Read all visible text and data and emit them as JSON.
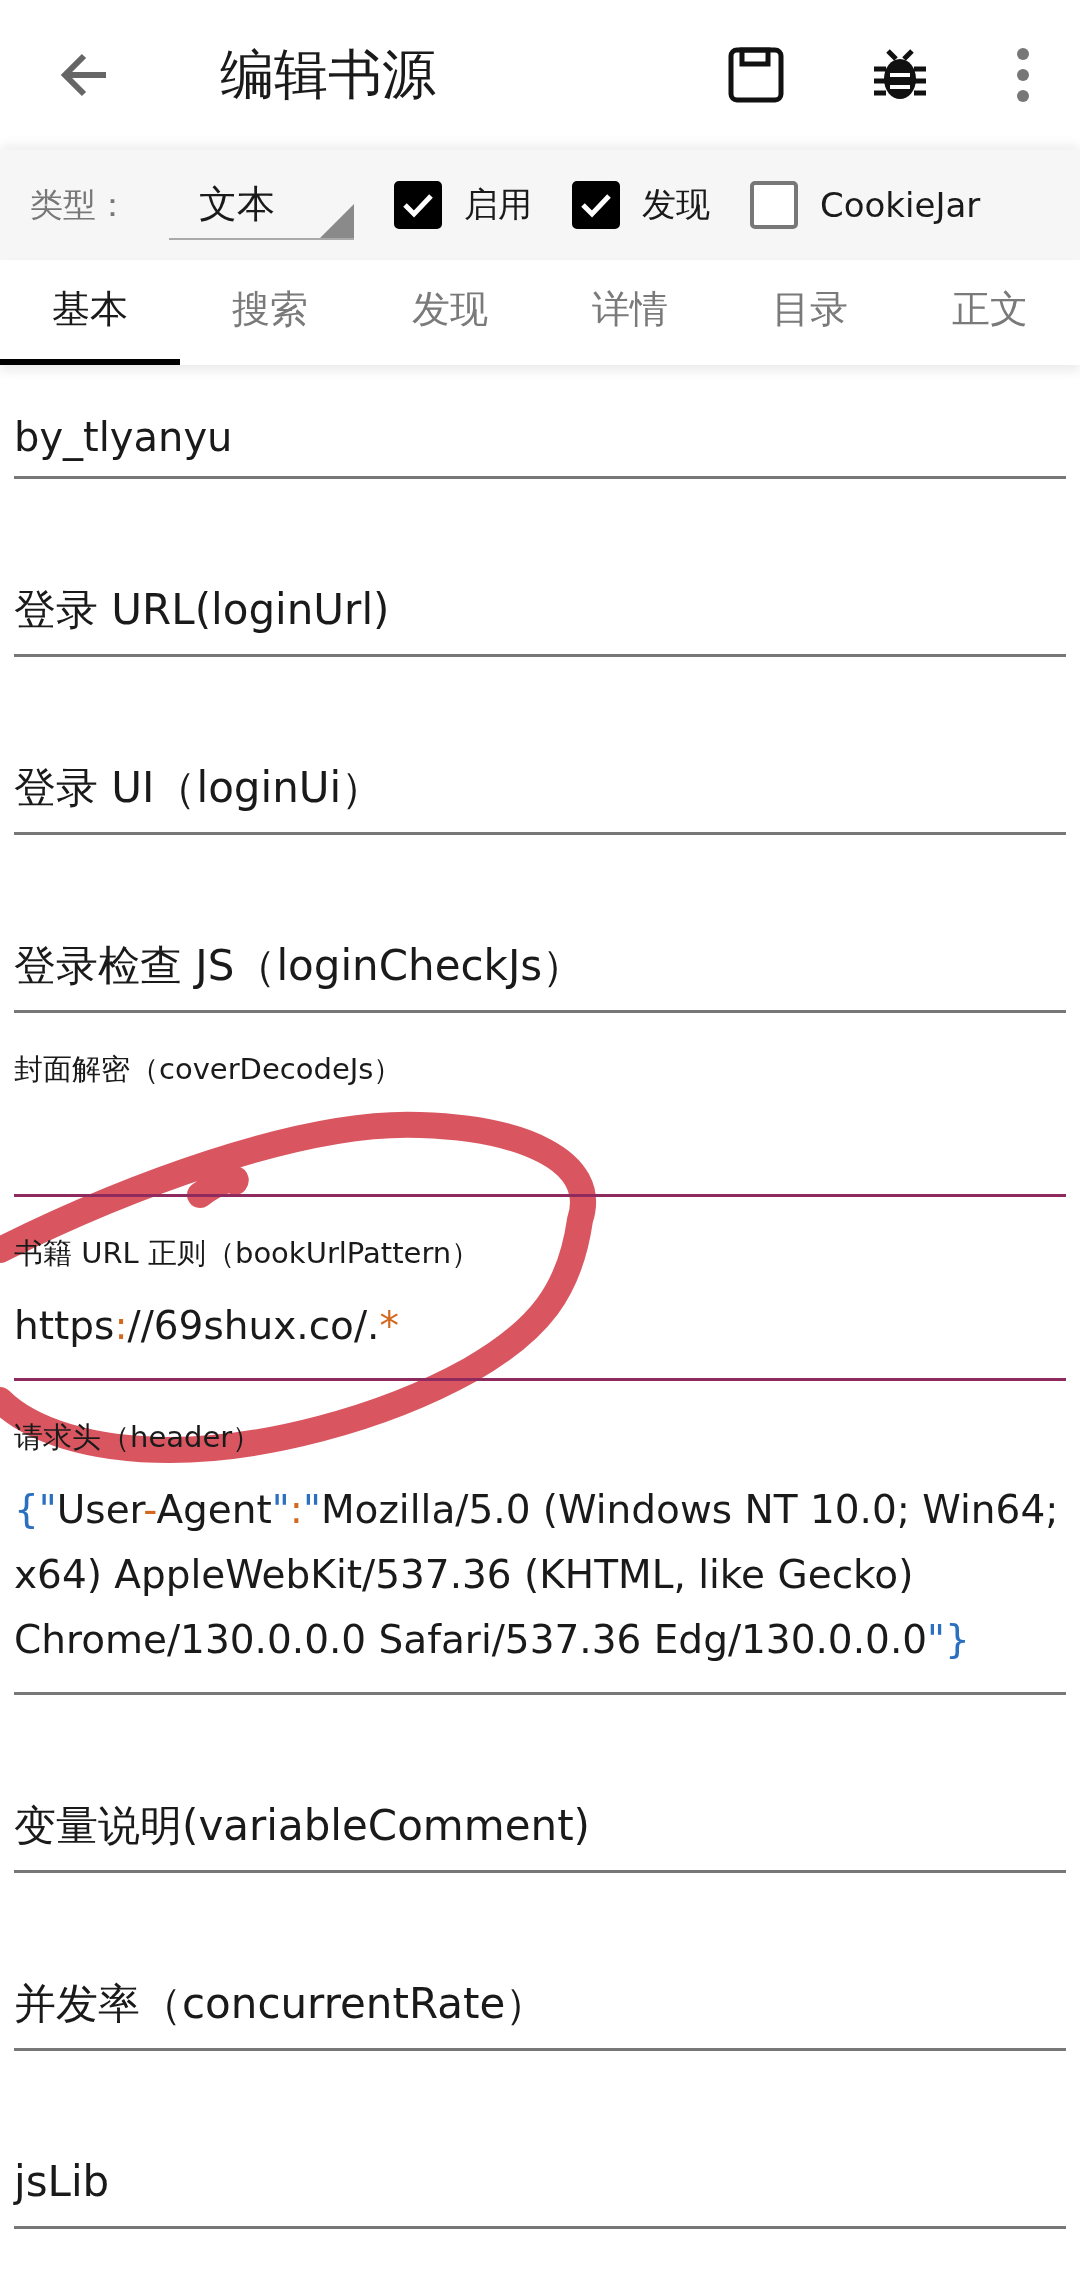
{
  "app_bar": {
    "title": "编辑书源"
  },
  "options": {
    "type_label": "类型：",
    "type_value": "文本",
    "checks": [
      {
        "label": "启用",
        "checked": true
      },
      {
        "label": "发现",
        "checked": true
      },
      {
        "label": "CookieJar",
        "checked": false
      }
    ]
  },
  "tabs": [
    {
      "label": "基本",
      "selected": true
    },
    {
      "label": "搜索",
      "selected": false
    },
    {
      "label": "发现",
      "selected": false
    },
    {
      "label": "详情",
      "selected": false
    },
    {
      "label": "目录",
      "selected": false
    },
    {
      "label": "正文",
      "selected": false
    }
  ],
  "fields": [
    {
      "kind": "cut",
      "focused": false,
      "value": [
        {
          "text": "by_tlyanyu",
          "color": "#1a1a1a"
        }
      ]
    },
    {
      "kind": "empty",
      "focused": false,
      "placeholder": "登录 URL(loginUrl)"
    },
    {
      "kind": "empty",
      "focused": false,
      "placeholder": "登录 UI（loginUi）"
    },
    {
      "kind": "empty",
      "focused": false,
      "placeholder": "登录检查 JS（loginCheckJs）"
    },
    {
      "kind": "filled",
      "focused": true,
      "label": "封面解密（coverDecodeJs）"
    },
    {
      "kind": "filled",
      "focused": true,
      "label": "书籍 URL 正则（bookUrlPattern）",
      "value": [
        {
          "text": "https",
          "color": "#1a1a1a"
        },
        {
          "text": ":",
          "color": "#d2691e"
        },
        {
          "text": "//69shux.co/.",
          "color": "#1a1a1a"
        },
        {
          "text": "*",
          "color": "#d2691e"
        }
      ]
    },
    {
      "kind": "filled",
      "focused": false,
      "label": "请求头（header）",
      "value": [
        {
          "text": "{\"",
          "color": "#2a6fc0"
        },
        {
          "text": "User",
          "color": "#1a1a1a"
        },
        {
          "text": "-",
          "color": "#d2691e"
        },
        {
          "text": "Agent",
          "color": "#1a1a1a"
        },
        {
          "text": "\"",
          "color": "#2a6fc0"
        },
        {
          "text": ":",
          "color": "#d2691e"
        },
        {
          "text": "\"",
          "color": "#2a6fc0"
        },
        {
          "text": "Mozilla/5.0 (Windows NT 10.0; Win64; x64) AppleWebKit/537.36 (KHTML, like Gecko) Chrome/130.0.0.0 Safari/537.36 Edg/130.0.0.0",
          "color": "#1a1a1a"
        },
        {
          "text": "\"}",
          "color": "#2a6fc0"
        }
      ]
    },
    {
      "kind": "empty",
      "focused": false,
      "placeholder": "变量说明(variableComment)"
    },
    {
      "kind": "empty",
      "focused": false,
      "placeholder": "并发率（concurrentRate）"
    },
    {
      "kind": "empty",
      "focused": false,
      "placeholder": "jsLib"
    }
  ]
}
